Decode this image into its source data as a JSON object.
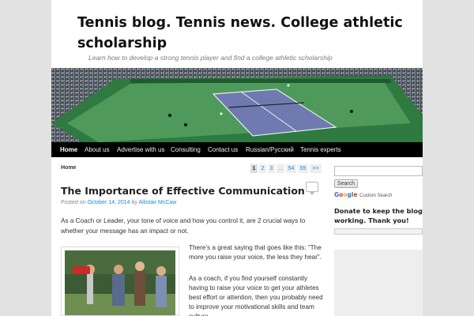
{
  "site": {
    "title": "Tennis blog. Tennis news. College athletic scholarship",
    "description": "Learn how to develop a strong tennis player and find a college athletic scholarship"
  },
  "nav": {
    "items": [
      {
        "label": "Home",
        "active": true
      },
      {
        "label": "About us"
      },
      {
        "label": "Advertise with us"
      },
      {
        "label": "Consulting"
      },
      {
        "label": "Contact us"
      },
      {
        "label": "Russian/Русский"
      },
      {
        "label": "Tennis experts"
      }
    ]
  },
  "breadcrumb": "Home",
  "pagination": {
    "current": "1",
    "pages": [
      "2",
      "3",
      "...",
      "54",
      "55",
      ">>"
    ]
  },
  "post": {
    "title": "The Importance of Effective Communication",
    "meta_prefix": "Posted on",
    "date": "October 14, 2014",
    "meta_by": "by",
    "author": "Allistair McCaw",
    "intro": "As a Coach or Leader, your tone of voice and how you control it, are 2 crucial ways to whether your message has an impact or not.",
    "para1": "There’s a great saying that goes like this: “The more you raise your voice, the less they hear”.",
    "para2": "As a coach, if you find yourself constantly having to raise your voice to get your athletes best effort or attention, then you probably need to improve your motivational skills and team culture."
  },
  "sidebar": {
    "search_button": "Search",
    "google_logo": "Google",
    "custom_search": "Custom Search",
    "donate_heading": "Donate to keep the blog working. Thank you!"
  },
  "colors": {
    "link": "#1b8be0",
    "nav_bg": "#000000",
    "court_surface": "#6f7bb0",
    "court_surround": "#4f9a5a"
  }
}
